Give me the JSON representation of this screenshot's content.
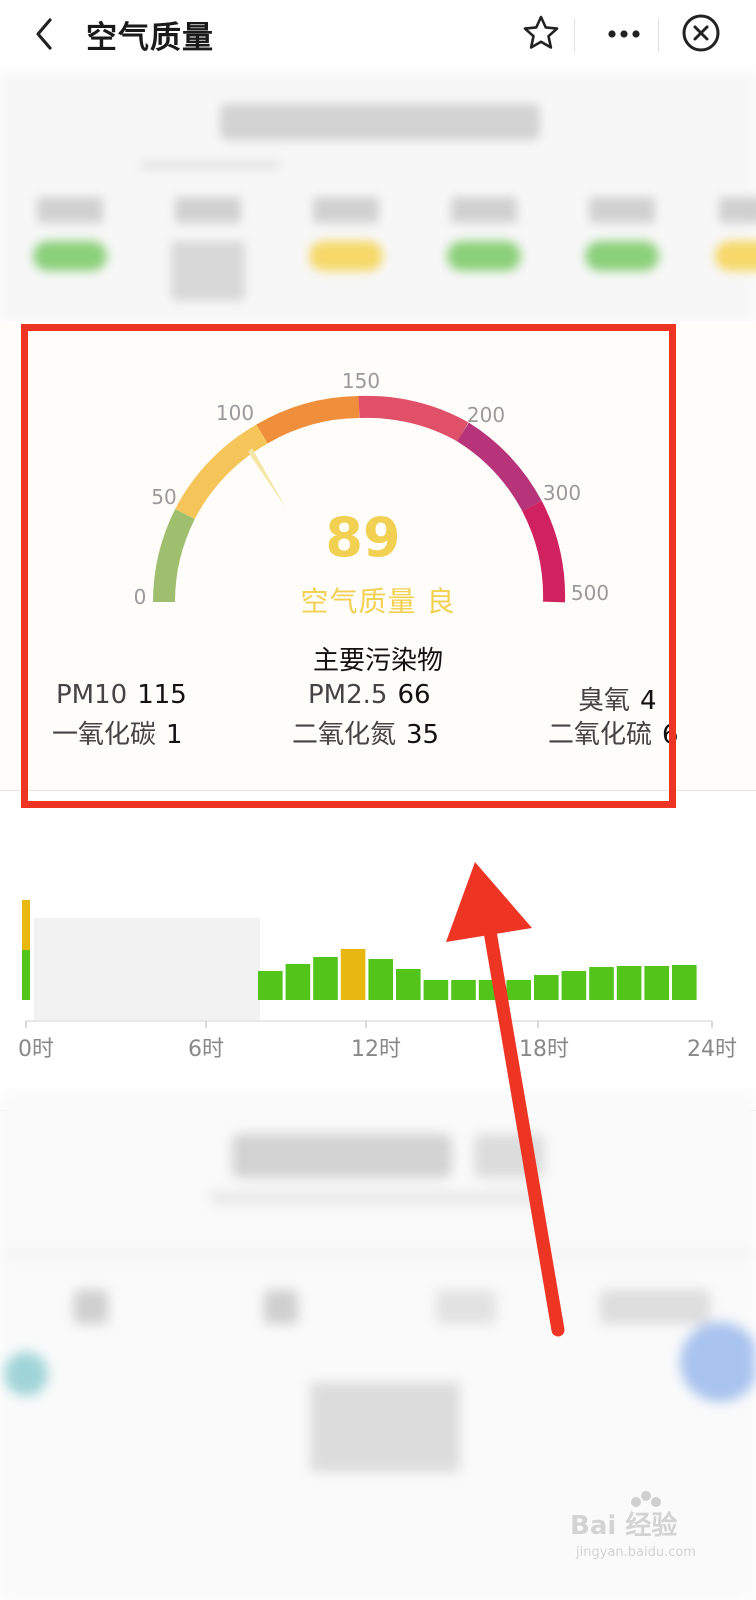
{
  "header": {
    "title": "空气质量",
    "back_icon": "chevron-left-icon",
    "favorite_icon": "star-icon",
    "more_icon": "more-dots-icon",
    "close_icon": "close-circle-icon"
  },
  "gauge": {
    "ticks": [
      "0",
      "50",
      "100",
      "150",
      "200",
      "300",
      "500"
    ],
    "aqi_value": "89",
    "aqi_label": "空气质量 良",
    "colors": {
      "band1": "#9fbf6f",
      "band2": "#f5c55a",
      "band3": "#f08f3b",
      "band4": "#e05069",
      "band5": "#b8347a",
      "band6": "#d12260",
      "aqi_text": "#f2d052"
    }
  },
  "pollutants": {
    "title": "主要污染物",
    "items": [
      {
        "name": "PM10",
        "value": "115"
      },
      {
        "name": "PM2.5",
        "value": "66"
      },
      {
        "name": "臭氧",
        "value": "4"
      },
      {
        "name": "一氧化碳",
        "value": "1"
      },
      {
        "name": "二氧化氮",
        "value": "35"
      },
      {
        "name": "二氧化硫",
        "value": "6"
      }
    ]
  },
  "hourly_chart": {
    "x_labels": [
      "0时",
      "6时",
      "12时",
      "18时",
      "24时"
    ],
    "bars": [
      {
        "hour": 0,
        "green": 50,
        "yellow": 50
      },
      {
        "hour": 9,
        "green": 29
      },
      {
        "hour": 10,
        "green": 36
      },
      {
        "hour": 11,
        "green": 43
      },
      {
        "hour": 12,
        "green": 0,
        "yellow": 51
      },
      {
        "hour": 13,
        "green": 41
      },
      {
        "hour": 14,
        "green": 31
      },
      {
        "hour": 15,
        "green": 20
      },
      {
        "hour": 16,
        "green": 20
      },
      {
        "hour": 17,
        "green": 20
      },
      {
        "hour": 18,
        "green": 20
      },
      {
        "hour": 19,
        "green": 25
      },
      {
        "hour": 20,
        "green": 29
      },
      {
        "hour": 21,
        "green": 33
      },
      {
        "hour": 22,
        "green": 34
      },
      {
        "hour": 23,
        "green": 34
      },
      {
        "hour": 24,
        "green": 35
      }
    ],
    "colors": {
      "good": "#52c41a",
      "moderate": "#e8b810",
      "empty": "#f2f2f2"
    }
  },
  "watermark": {
    "text": "Bai 经验",
    "sub": "jingyan.baidu.com"
  },
  "annotation": {
    "color": "#ee3524"
  }
}
